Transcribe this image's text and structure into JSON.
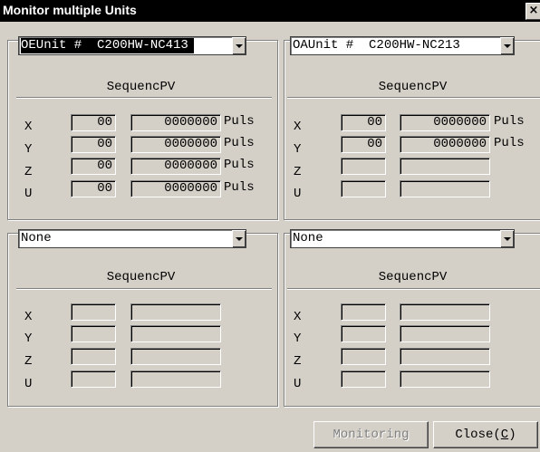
{
  "window": {
    "title": "Monitor multiple Units",
    "close_glyph": "×"
  },
  "panels": [
    {
      "unit": "OEUnit #  C200HW-NC413",
      "selected": true,
      "header": "SequencPV",
      "rows": [
        {
          "axis": "X",
          "seq": "00",
          "pv": "0000000",
          "unit": "Puls"
        },
        {
          "axis": "Y",
          "seq": "00",
          "pv": "0000000",
          "unit": "Puls"
        },
        {
          "axis": "Z",
          "seq": "00",
          "pv": "0000000",
          "unit": "Puls"
        },
        {
          "axis": "U",
          "seq": "00",
          "pv": "0000000",
          "unit": "Puls"
        }
      ]
    },
    {
      "unit": "OAUnit #  C200HW-NC213",
      "selected": false,
      "header": "SequencPV",
      "rows": [
        {
          "axis": "X",
          "seq": "00",
          "pv": "0000000",
          "unit": "Puls"
        },
        {
          "axis": "Y",
          "seq": "00",
          "pv": "0000000",
          "unit": "Puls"
        },
        {
          "axis": "Z",
          "seq": "",
          "pv": "",
          "unit": ""
        },
        {
          "axis": "U",
          "seq": "",
          "pv": "",
          "unit": ""
        }
      ]
    },
    {
      "unit": "None",
      "selected": false,
      "header": "SequencPV",
      "rows": [
        {
          "axis": "X",
          "seq": "",
          "pv": "",
          "unit": ""
        },
        {
          "axis": "Y",
          "seq": "",
          "pv": "",
          "unit": ""
        },
        {
          "axis": "Z",
          "seq": "",
          "pv": "",
          "unit": ""
        },
        {
          "axis": "U",
          "seq": "",
          "pv": "",
          "unit": ""
        }
      ]
    },
    {
      "unit": "None",
      "selected": false,
      "header": "SequencPV",
      "rows": [
        {
          "axis": "X",
          "seq": "",
          "pv": "",
          "unit": ""
        },
        {
          "axis": "Y",
          "seq": "",
          "pv": "",
          "unit": ""
        },
        {
          "axis": "Z",
          "seq": "",
          "pv": "",
          "unit": ""
        },
        {
          "axis": "U",
          "seq": "",
          "pv": "",
          "unit": ""
        }
      ]
    }
  ],
  "buttons": {
    "monitoring": "Monitoring",
    "close_prefix": "Close(",
    "close_accel": "C",
    "close_suffix": ")"
  }
}
